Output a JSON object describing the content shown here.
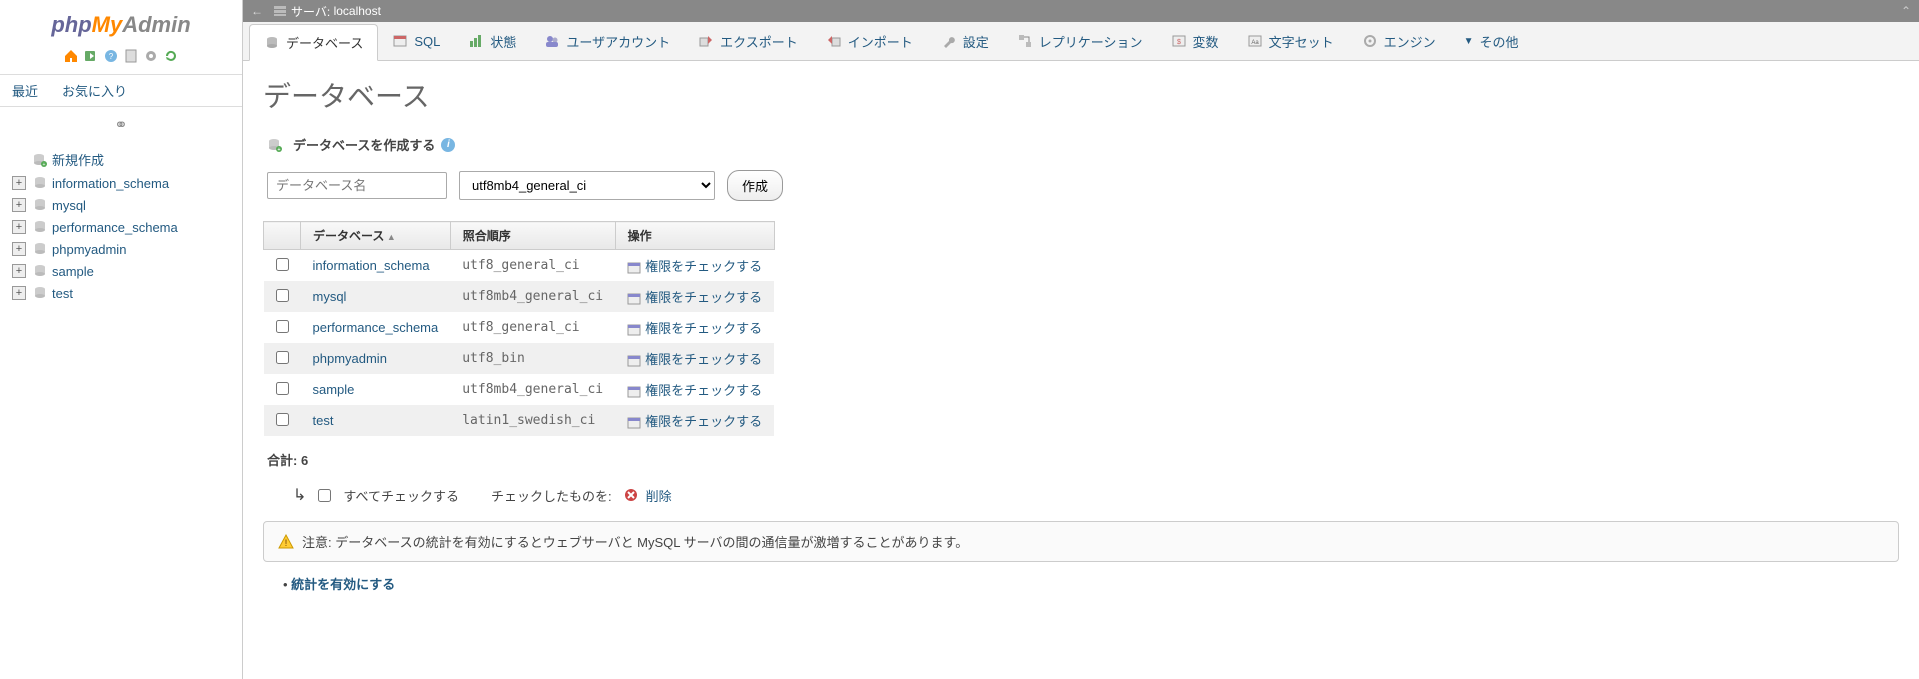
{
  "logo": {
    "php": "php",
    "my": "My",
    "admin": "Admin"
  },
  "sidebar": {
    "recent_label": "最近",
    "favorites_label": "お気に入り",
    "new_label": "新規作成",
    "databases": [
      "information_schema",
      "mysql",
      "performance_schema",
      "phpmyadmin",
      "sample",
      "test"
    ]
  },
  "topbar": {
    "server_prefix": "サーバ:",
    "server_name": "localhost"
  },
  "tabs": [
    {
      "label": "データベース",
      "icon": "db"
    },
    {
      "label": "SQL",
      "icon": "sql"
    },
    {
      "label": "状態",
      "icon": "status"
    },
    {
      "label": "ユーザアカウント",
      "icon": "users"
    },
    {
      "label": "エクスポート",
      "icon": "export"
    },
    {
      "label": "インポート",
      "icon": "import"
    },
    {
      "label": "設定",
      "icon": "wrench"
    },
    {
      "label": "レプリケーション",
      "icon": "replication"
    },
    {
      "label": "変数",
      "icon": "vars"
    },
    {
      "label": "文字セット",
      "icon": "charset"
    },
    {
      "label": "エンジン",
      "icon": "engine"
    },
    {
      "label": "その他",
      "icon": "more"
    }
  ],
  "page": {
    "title": "データベース",
    "create_heading": "データベースを作成する",
    "db_name_placeholder": "データベース名",
    "collation_value": "utf8mb4_general_ci",
    "create_button": "作成"
  },
  "table": {
    "columns": {
      "db": "データベース",
      "collation": "照合順序",
      "action": "操作"
    },
    "check_privileges": "権限をチェックする",
    "rows": [
      {
        "name": "information_schema",
        "collation": "utf8_general_ci"
      },
      {
        "name": "mysql",
        "collation": "utf8mb4_general_ci"
      },
      {
        "name": "performance_schema",
        "collation": "utf8_general_ci"
      },
      {
        "name": "phpmyadmin",
        "collation": "utf8_bin"
      },
      {
        "name": "sample",
        "collation": "utf8mb4_general_ci"
      },
      {
        "name": "test",
        "collation": "latin1_swedish_ci"
      }
    ],
    "total_label": "合計:",
    "total_count": "6"
  },
  "checkall": {
    "check_all": "すべてチェックする",
    "with_selected": "チェックしたものを:",
    "delete": "削除"
  },
  "notice": "注意: データベースの統計を有効にするとウェブサーバと MySQL サーバの間の通信量が激増することがあります。",
  "stats_link": "統計を有効にする"
}
